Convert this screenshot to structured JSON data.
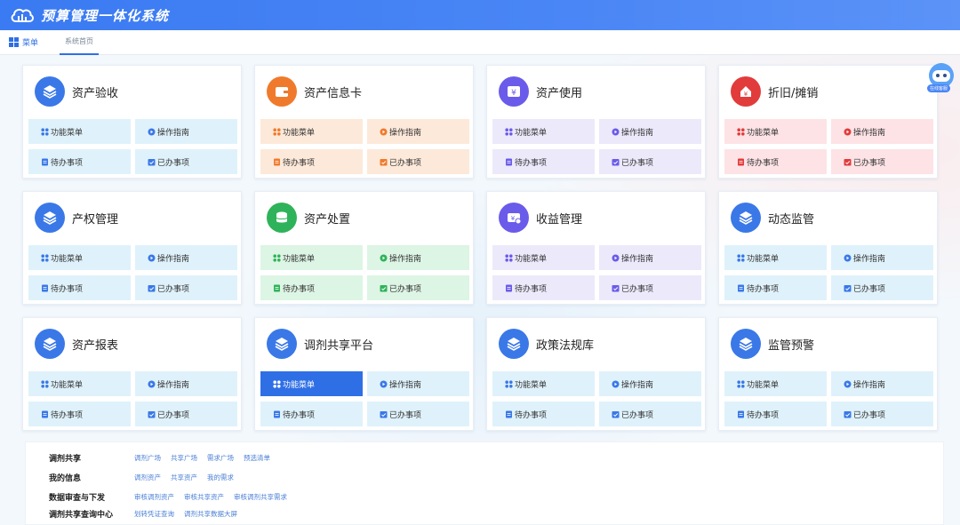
{
  "header": {
    "title": "预算管理一体化系统"
  },
  "tabbar": {
    "menu_label": "菜单",
    "home_tab": "系统首页"
  },
  "assistant": {
    "label": "在线客服"
  },
  "cards": [
    {
      "title": "资产验收",
      "theme": "blue",
      "icon": "layers-icon",
      "color": "#3a78e8"
    },
    {
      "title": "资产信息卡",
      "theme": "orange",
      "icon": "wallet-icon",
      "color": "#f07a2c"
    },
    {
      "title": "资产使用",
      "theme": "purple",
      "icon": "yen-card-icon",
      "color": "#6a5bea"
    },
    {
      "title": "折旧/摊销",
      "theme": "red",
      "icon": "depreciation-icon",
      "color": "#e23b3b"
    },
    {
      "title": "产权管理",
      "theme": "blue",
      "icon": "layers-icon",
      "color": "#3a78e8"
    },
    {
      "title": "资产处置",
      "theme": "green",
      "icon": "coin-stack-icon",
      "color": "#2fb35a"
    },
    {
      "title": "收益管理",
      "theme": "purple",
      "icon": "income-icon",
      "color": "#6a5bea"
    },
    {
      "title": "动态监管",
      "theme": "blue",
      "icon": "layers-icon",
      "color": "#3a78e8"
    },
    {
      "title": "资产报表",
      "theme": "blue",
      "icon": "layers-icon",
      "color": "#3a78e8"
    },
    {
      "title": "调剂共享平台",
      "theme": "blue",
      "icon": "layers-icon",
      "color": "#3a78e8"
    },
    {
      "title": "政策法规库",
      "theme": "blue",
      "icon": "layers-icon",
      "color": "#3a78e8"
    },
    {
      "title": "监管预警",
      "theme": "blue",
      "icon": "layers-icon",
      "color": "#3a78e8"
    }
  ],
  "card_buttons": {
    "function_menu": "功能菜单",
    "guide": "操作指南",
    "todo": "待办事项",
    "done": "已办事项"
  },
  "bottom_links": [
    {
      "label": "调剂共享",
      "links": [
        "调剂广场",
        "共享广场",
        "需求广场",
        "预选清单"
      ]
    },
    {
      "label": "我的信息",
      "links": [
        "调剂资产",
        "共享资产",
        "我的需求"
      ]
    },
    {
      "label": "数据审查与下发",
      "links": [
        "审核调剂资产",
        "审核共享资产",
        "审核调剂共享需求"
      ]
    },
    {
      "label": "调剂共享查询中心",
      "links": [
        "划转凭证查询",
        "调剂共享数据大屏"
      ]
    }
  ],
  "colors": {
    "accent": "#2f6fe6",
    "header": "#3a7af2"
  }
}
